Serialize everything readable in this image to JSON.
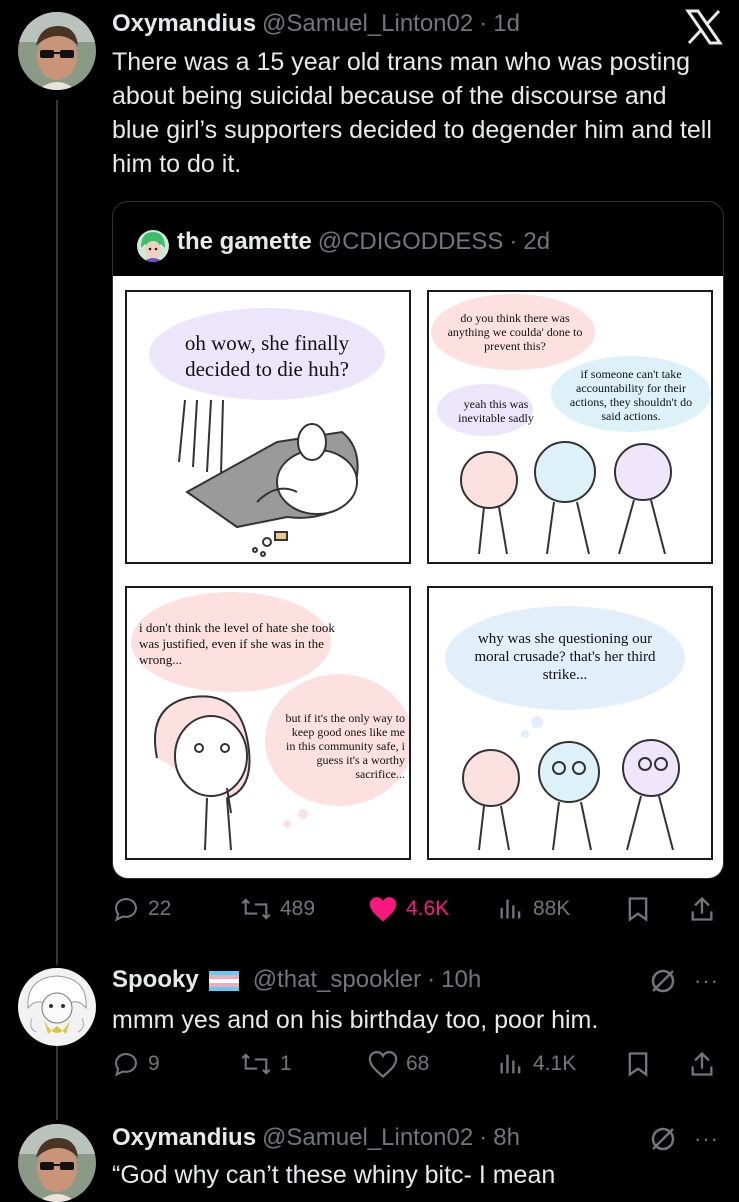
{
  "posts": [
    {
      "display_name": "Oxymandius",
      "handle": "@Samuel_Linton02",
      "time": "1d",
      "text": "There was a 15 year old trans man who was posting about being suicidal because of the discourse and blue girl’s supporters decided to degender him and tell him to do it.",
      "quoted": {
        "display_name": "the gamette",
        "handle": "@CDIGODDESS",
        "time": "2d",
        "comic": {
          "panel1": "oh wow, she finally decided to die huh?",
          "panel2_a": "do you think there was anything we coulda' done to prevent this?",
          "panel2_b": "yeah this was inevitable sadly",
          "panel2_c": "if someone can't take accountability for their actions, they shouldn't do said actions.",
          "panel3_a": "i don't think the level of hate she took was justified, even if she was in the wrong...",
          "panel3_b": "but if it's the only way to keep good ones like me in this community safe, i guess it's a worthy sacrifice...",
          "panel4": "why was she questioning our moral crusade? that's her third strike..."
        }
      },
      "stats": {
        "replies": "22",
        "reposts": "489",
        "likes": "4.6K",
        "views": "88K"
      }
    },
    {
      "display_name": "Spooky",
      "handle": "@that_spookler",
      "time": "10h",
      "text": "mmm yes and on his birthday too, poor him.",
      "stats": {
        "replies": "9",
        "reposts": "1",
        "likes": "68",
        "views": "4.1K"
      }
    },
    {
      "display_name": "Oxymandius",
      "handle": "@Samuel_Linton02",
      "time": "8h",
      "text": "“God why can’t these whiny bitc- I mean"
    }
  ],
  "ui": {
    "dot": "·",
    "more": "···",
    "close_glyph": "X"
  },
  "colors": {
    "like_active": "#f91880",
    "muted": "#71767b",
    "background": "#000000",
    "text": "#e7e9ea"
  },
  "icons": [
    "reply-icon",
    "repost-icon",
    "heart-icon",
    "views-icon",
    "bookmark-icon",
    "share-icon",
    "grok-icon",
    "more-icon",
    "x-close-icon",
    "trans-flag-icon"
  ]
}
